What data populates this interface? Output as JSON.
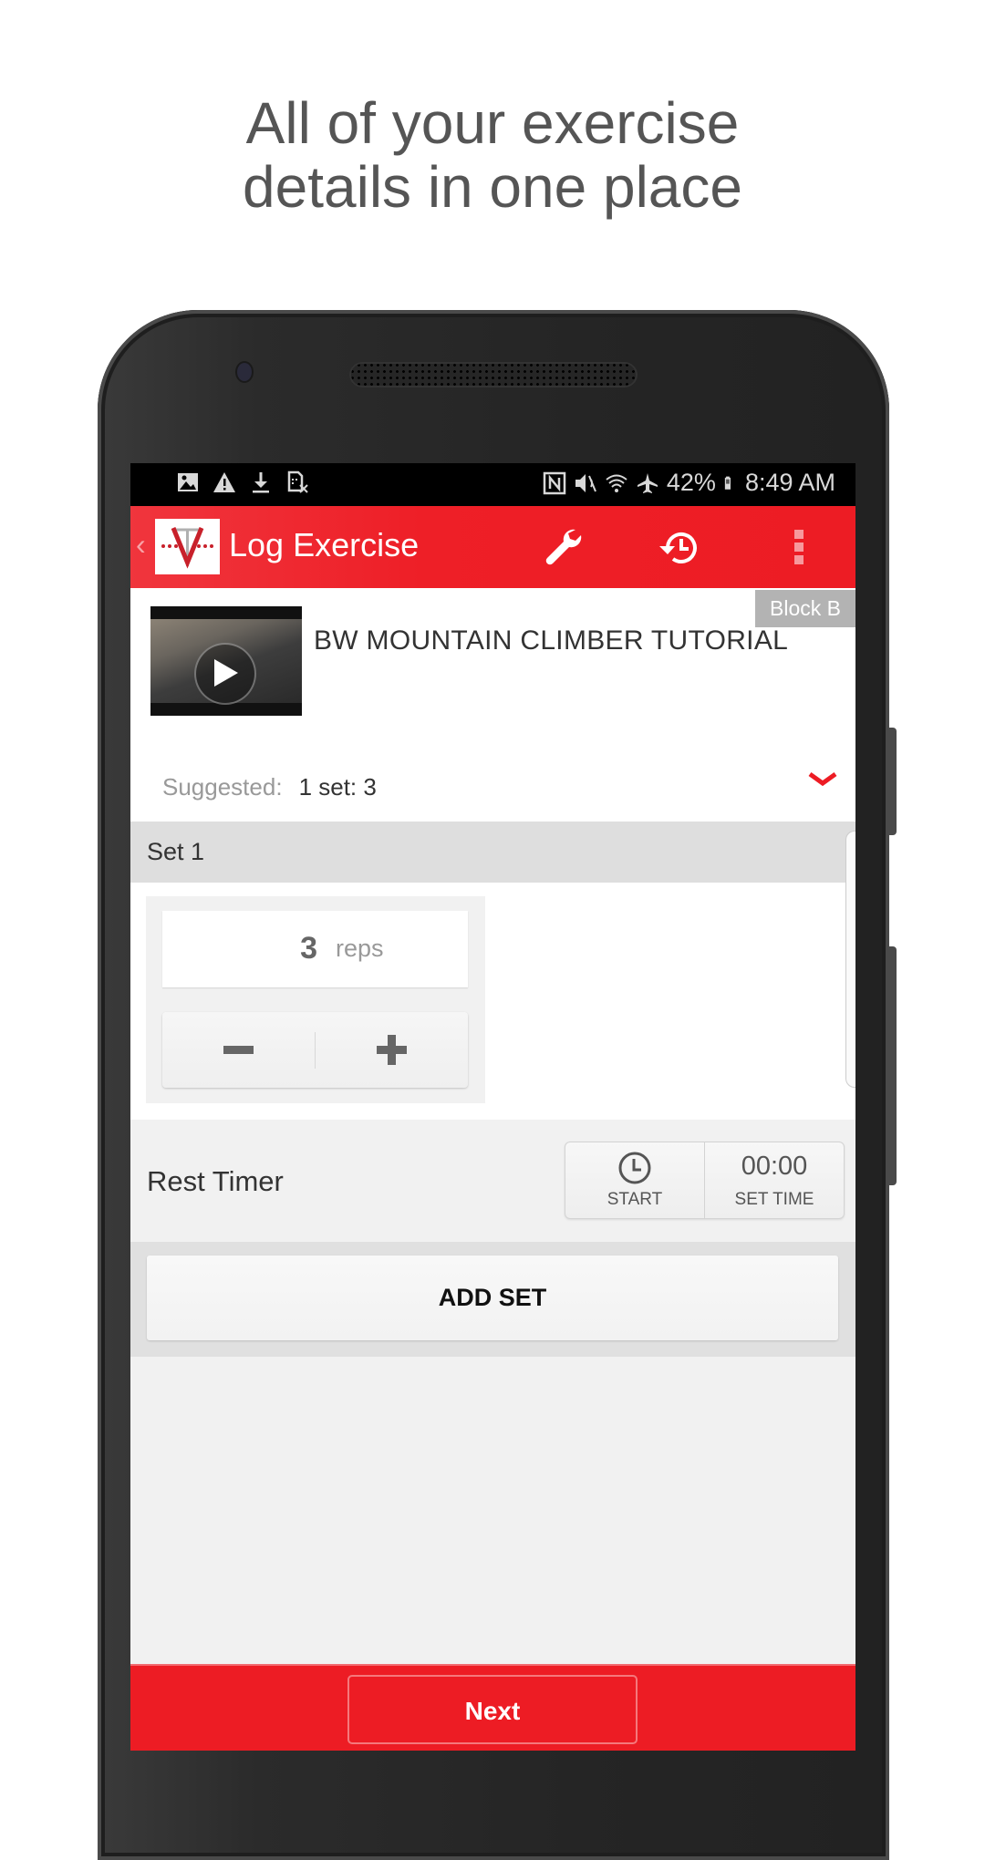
{
  "headline": {
    "line1": "All of your exercise",
    "line2": "details in one place"
  },
  "status_bar": {
    "left_icons": [
      "image-icon",
      "warning-icon",
      "download-icon",
      "sim-card-error-icon"
    ],
    "right_icons": [
      "nfc-icon",
      "vibrate-mute-icon",
      "wifi-icon",
      "airplane-icon"
    ],
    "battery_percent": "42%",
    "time": "8:49 AM"
  },
  "app_bar": {
    "title": "Log Exercise",
    "back_glyph": "‹",
    "actions": [
      "wrench-icon",
      "history-icon",
      "overflow-menu-icon"
    ]
  },
  "exercise": {
    "title": "BW MOUNTAIN CLIMBER TUTORIAL",
    "block_tag": "Block B",
    "suggested_label": "Suggested:",
    "suggested_value": "1 set: 3"
  },
  "set": {
    "header": "Set 1",
    "reps_value": "3",
    "reps_unit": "reps",
    "decrement_glyph": "−",
    "increment_glyph": "+"
  },
  "rest_timer": {
    "label": "Rest Timer",
    "start_label": "START",
    "time_value": "00:00",
    "set_time_label": "SET TIME"
  },
  "add_set": {
    "label": "ADD SET"
  },
  "footer": {
    "next_label": "Next"
  },
  "colors": {
    "brand_red": "#ed1c24",
    "text_dark": "#333333",
    "text_muted": "#999999",
    "set_header_bg": "#dedede",
    "block_tag_bg": "#b3b3b3"
  }
}
